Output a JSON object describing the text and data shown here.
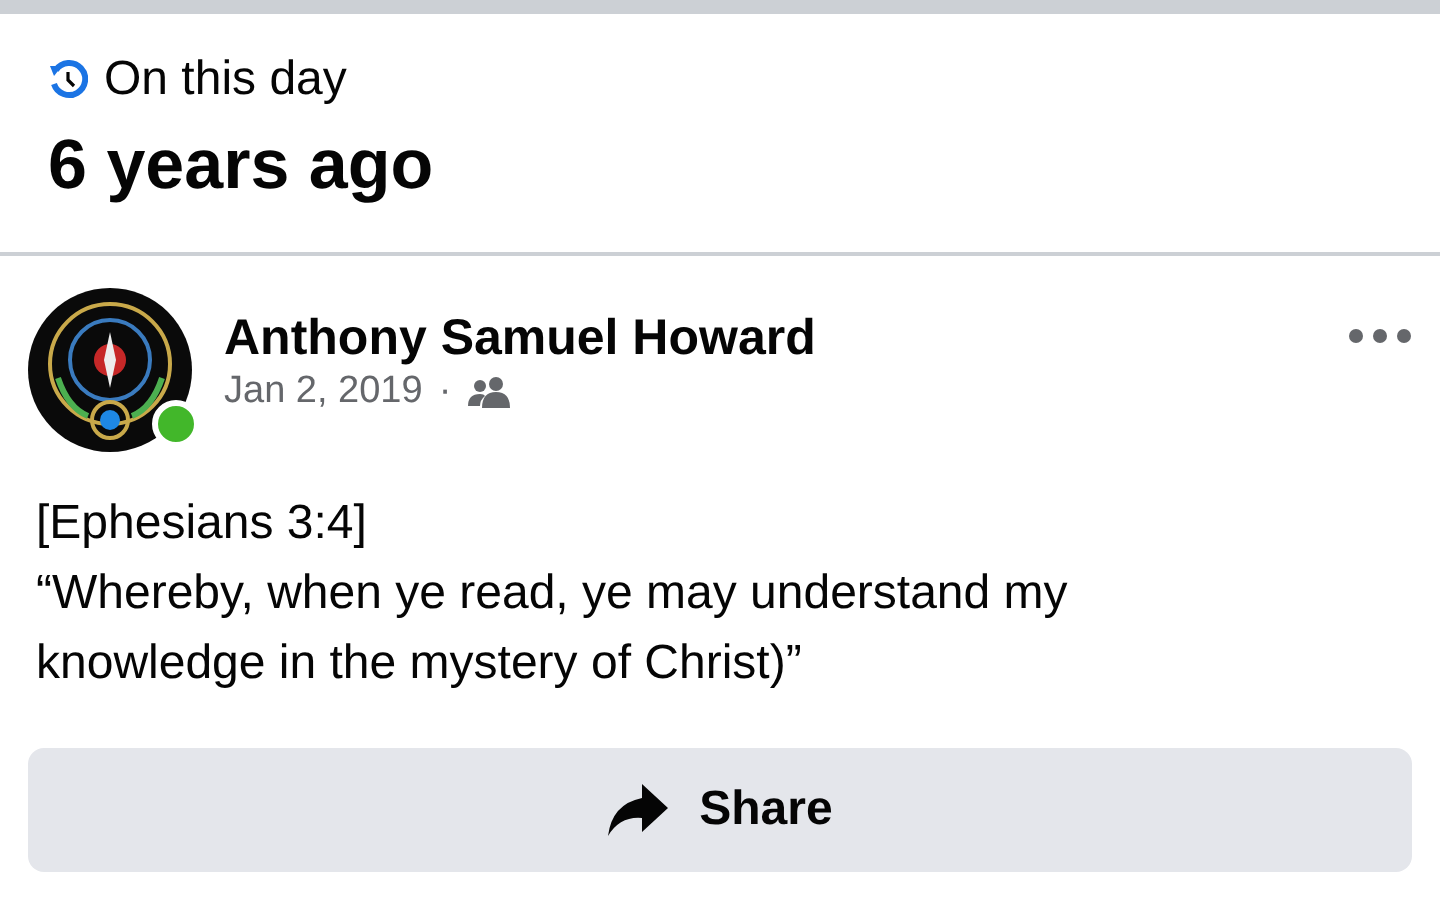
{
  "memory": {
    "label": "On this day",
    "title": "6 years ago"
  },
  "post": {
    "author": "Anthony Samuel Howard",
    "online": true,
    "date": "Jan 2, 2019",
    "separator": "·",
    "audience_icon": {
      "kind": "friends"
    },
    "text_lines": [
      "[Ephesians 3:4]",
      "“Whereby, when ye read, ye may understand my",
      "knowledge in the mystery of Christ)”"
    ]
  },
  "share_button": {
    "label": "Share"
  }
}
